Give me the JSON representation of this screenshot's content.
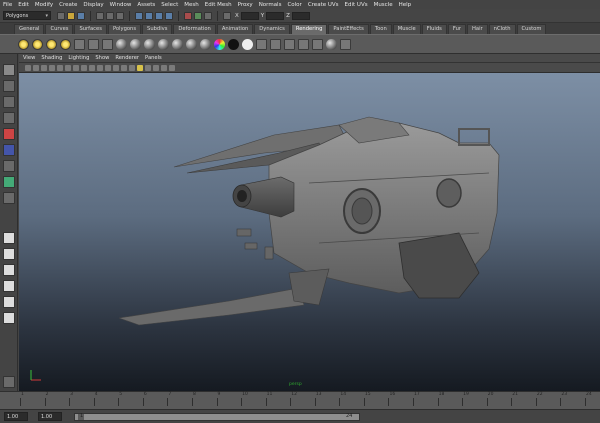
{
  "menubar": [
    "File",
    "Edit",
    "Modify",
    "Create",
    "Display",
    "Window",
    "Assets",
    "Select",
    "Mesh",
    "Edit Mesh",
    "Proxy",
    "Normals",
    "Color",
    "Create UVs",
    "Edit UVs",
    "Muscle",
    "Help"
  ],
  "status_line": {
    "menu_set": "Polygons",
    "coord_labels": [
      "X",
      "Y",
      "Z"
    ]
  },
  "shelf_tabs": [
    "General",
    "Curves",
    "Surfaces",
    "Polygons",
    "Subdivs",
    "Deformation",
    "Animation",
    "Dynamics",
    "Rendering",
    "PaintEffects",
    "Toon",
    "Muscle",
    "Fluids",
    "Fur",
    "Hair",
    "nCloth",
    "Custom"
  ],
  "active_shelf_tab": "Rendering",
  "panel_menu": [
    "View",
    "Shading",
    "Lighting",
    "Show",
    "Renderer",
    "Panels"
  ],
  "viewport": {
    "camera_label": "persp"
  },
  "time_slider": {
    "tick_labels": [
      "1",
      "2",
      "3",
      "4",
      "5",
      "6",
      "7",
      "8",
      "9",
      "10",
      "11",
      "12",
      "13",
      "14",
      "15",
      "16",
      "17",
      "18",
      "19",
      "20",
      "21",
      "22",
      "23",
      "24"
    ]
  },
  "range_slider": {
    "start": "1.00",
    "current": "1.00",
    "range_start_label": "1",
    "range_end_label": "24"
  },
  "colors": {
    "accent": "#6a6a6a",
    "viewport_top": "#7d8fa5",
    "viewport_bottom": "#151a21",
    "axis_x": "#d13a3a",
    "axis_y": "#3ac13a"
  }
}
